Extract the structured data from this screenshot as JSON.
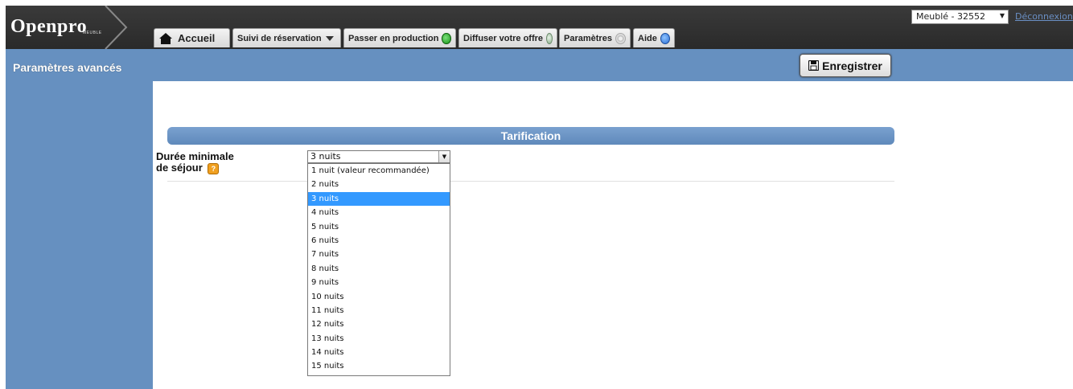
{
  "header": {
    "logo": "Openpro",
    "logo_sub": "MEUBLE",
    "tabs": [
      {
        "label": "Accueil",
        "icon": "home-icon"
      },
      {
        "label": "Suivi de réservation",
        "icon": "chevron-down-icon"
      },
      {
        "label": "Passer en production",
        "icon": "green-status-icon"
      },
      {
        "label": "Diffuser votre offre",
        "icon": "share-icon"
      },
      {
        "label": "Paramètres",
        "icon": "gear-icon"
      },
      {
        "label": "Aide",
        "icon": "help-icon"
      }
    ],
    "account": "Meublé - 32552",
    "logout": "Déconnexion"
  },
  "toolbar": {
    "page_title": "Paramètres avancés",
    "save_label": "Enregistrer"
  },
  "section": {
    "title": "Tarification",
    "field_label_line1": "Durée minimale",
    "field_label_line2": "de séjour",
    "help_glyph": "?",
    "selected": "3 nuits",
    "options": [
      "1 nuit (valeur recommandée)",
      "2 nuits",
      "3 nuits",
      "4 nuits",
      "5 nuits",
      "6 nuits",
      "7 nuits",
      "8 nuits",
      "9 nuits",
      "10 nuits",
      "11 nuits",
      "12 nuits",
      "13 nuits",
      "14 nuits",
      "15 nuits"
    ],
    "selected_index": 2
  },
  "colors": {
    "header_bg": "#2e2e2e",
    "accent_blue": "#6690c0",
    "selected_option": "#3399ff",
    "status_green": "#22aa22",
    "help_orange": "#f0a020"
  }
}
